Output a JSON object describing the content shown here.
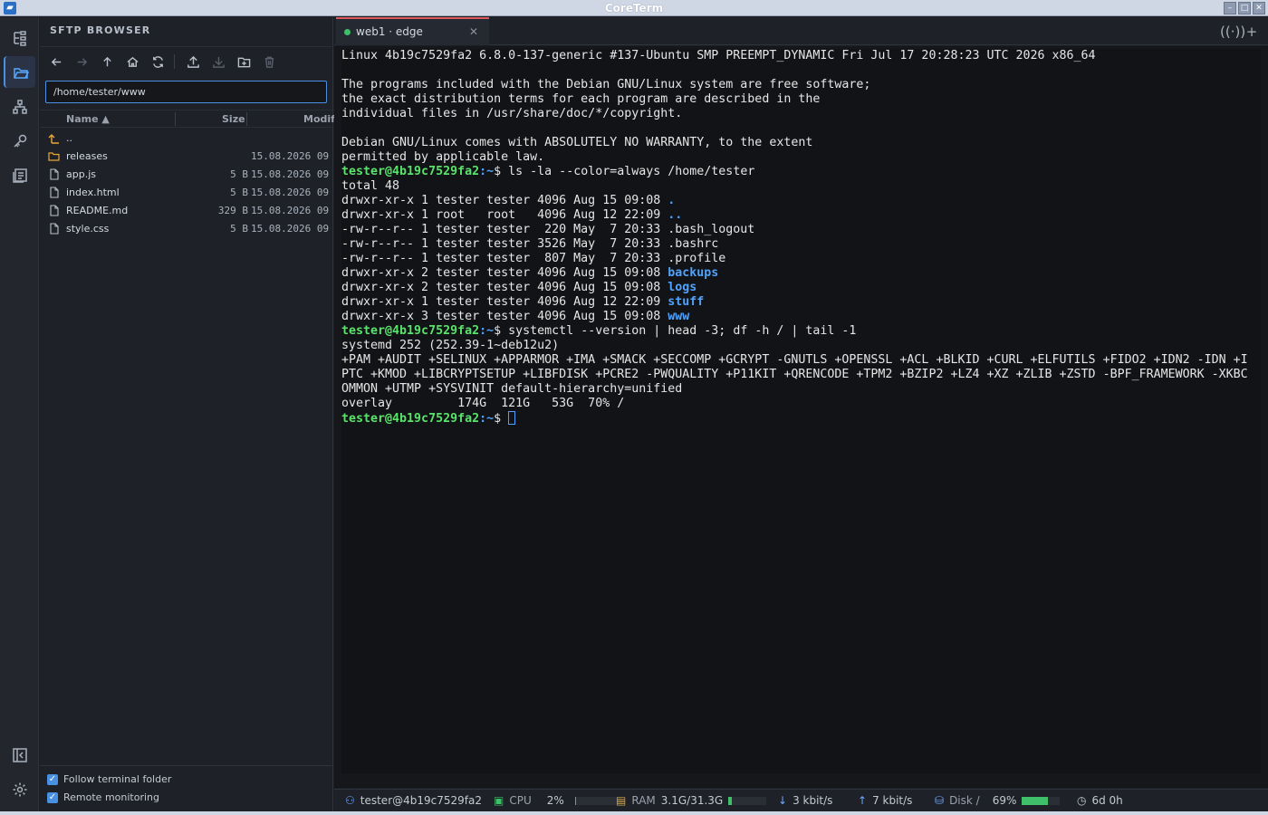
{
  "window": {
    "title": "CoreTerm"
  },
  "sidebar": {
    "title": "SFTP BROWSER",
    "path": "/home/tester/www",
    "columns": {
      "name": "Name ▲",
      "size": "Size",
      "modified": "Modif"
    },
    "files": [
      {
        "name": "..",
        "size": "",
        "date": "",
        "type": "up"
      },
      {
        "name": "releases",
        "size": "",
        "date": "15.08.2026 09",
        "type": "folder"
      },
      {
        "name": "app.js",
        "size": "5 B",
        "date": "15.08.2026 09",
        "type": "file"
      },
      {
        "name": "index.html",
        "size": "5 B",
        "date": "15.08.2026 09",
        "type": "file"
      },
      {
        "name": "README.md",
        "size": "329 B",
        "date": "15.08.2026 09",
        "type": "file"
      },
      {
        "name": "style.css",
        "size": "5 B",
        "date": "15.08.2026 09",
        "type": "file"
      }
    ],
    "follow_terminal_folder": "Follow terminal folder",
    "remote_monitoring": "Remote monitoring"
  },
  "tab": {
    "label": "web1 · edge",
    "status_color": "#3fbf6a"
  },
  "terminal": {
    "prompt_user": "tester@4b19c7529fa2",
    "prompt_path": ":~",
    "prompt_symbol": "$",
    "lines": [
      {
        "t": "Linux 4b19c7529fa2 6.8.0-137-generic #137-Ubuntu SMP PREEMPT_DYNAMIC Fri Jul 17 20:28:23 UTC 2026 x86_64"
      },
      {
        "t": ""
      },
      {
        "t": "The programs included with the Debian GNU/Linux system are free software;"
      },
      {
        "t": "the exact distribution terms for each program are described in the"
      },
      {
        "t": "individual files in /usr/share/doc/*/copyright."
      },
      {
        "t": ""
      },
      {
        "t": "Debian GNU/Linux comes with ABSOLUTELY NO WARRANTY, to the extent"
      },
      {
        "t": "permitted by applicable law."
      },
      {
        "cmd": " ls -la --color=always /home/tester"
      },
      {
        "t": "total 48"
      },
      {
        "t": "drwxr-xr-x 1 tester tester 4096 Aug 15 09:08 ",
        "d": "."
      },
      {
        "t": "drwxr-xr-x 1 root   root   4096 Aug 12 22:09 ",
        "d": ".."
      },
      {
        "t": "-rw-r--r-- 1 tester tester  220 May  7 20:33 .bash_logout"
      },
      {
        "t": "-rw-r--r-- 1 tester tester 3526 May  7 20:33 .bashrc"
      },
      {
        "t": "-rw-r--r-- 1 tester tester  807 May  7 20:33 .profile"
      },
      {
        "t": "drwxr-xr-x 2 tester tester 4096 Aug 15 09:08 ",
        "d": "backups"
      },
      {
        "t": "drwxr-xr-x 2 tester tester 4096 Aug 15 09:08 ",
        "d": "logs"
      },
      {
        "t": "drwxr-xr-x 1 tester tester 4096 Aug 12 22:09 ",
        "d": "stuff"
      },
      {
        "t": "drwxr-xr-x 3 tester tester 4096 Aug 15 09:08 ",
        "d": "www"
      },
      {
        "cmd": " systemctl --version | head -3; df -h / | tail -1"
      },
      {
        "t": "systemd 252 (252.39-1~deb12u2)"
      },
      {
        "t": "+PAM +AUDIT +SELINUX +APPARMOR +IMA +SMACK +SECCOMP +GCRYPT -GNUTLS +OPENSSL +ACL +BLKID +CURL +ELFUTILS +FIDO2 +IDN2 -IDN +I"
      },
      {
        "t": "PTC +KMOD +LIBCRYPTSETUP +LIBFDISK +PCRE2 -PWQUALITY +P11KIT +QRENCODE +TPM2 +BZIP2 +LZ4 +XZ +ZLIB +ZSTD -BPF_FRAMEWORK -XKBC"
      },
      {
        "t": "OMMON +UTMP +SYSVINIT default-hierarchy=unified"
      },
      {
        "t": "overlay         174G  121G   53G  70% /"
      },
      {
        "cmd": " ",
        "cursor": true
      }
    ]
  },
  "status": {
    "host": "tester@4b19c7529fa2",
    "cpu_label": "CPU",
    "cpu_value": "2%",
    "cpu_fraction": 0.02,
    "ram_label": "RAM",
    "ram_value": "3.1G/31.3G",
    "ram_fraction": 0.1,
    "down": "3 kbit/s",
    "up": "7 kbit/s",
    "disk_label": "Disk /",
    "disk_value": "69%",
    "disk_fraction": 0.69,
    "uptime": "6d 0h",
    "accent": "#4a90e2",
    "ok_color": "#3fbf6a"
  }
}
